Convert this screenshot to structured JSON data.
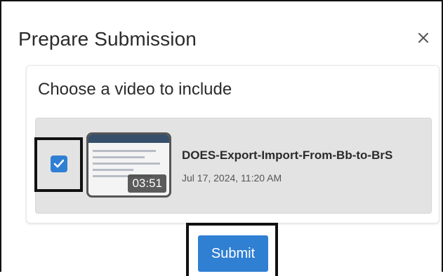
{
  "dialog": {
    "title": "Prepare Submission",
    "close_icon": "close-icon"
  },
  "card": {
    "heading": "Choose a video to include"
  },
  "video": {
    "selected": true,
    "duration": "03:51",
    "title": "DOES-Export-Import-From-Bb-to-BrS",
    "date": "Jul 17, 2024, 11:20 AM"
  },
  "submit": {
    "label": "Submit"
  },
  "colors": {
    "accent": "#2f7fd3",
    "row_bg": "#e3e3e3",
    "highlight": "#111111"
  }
}
